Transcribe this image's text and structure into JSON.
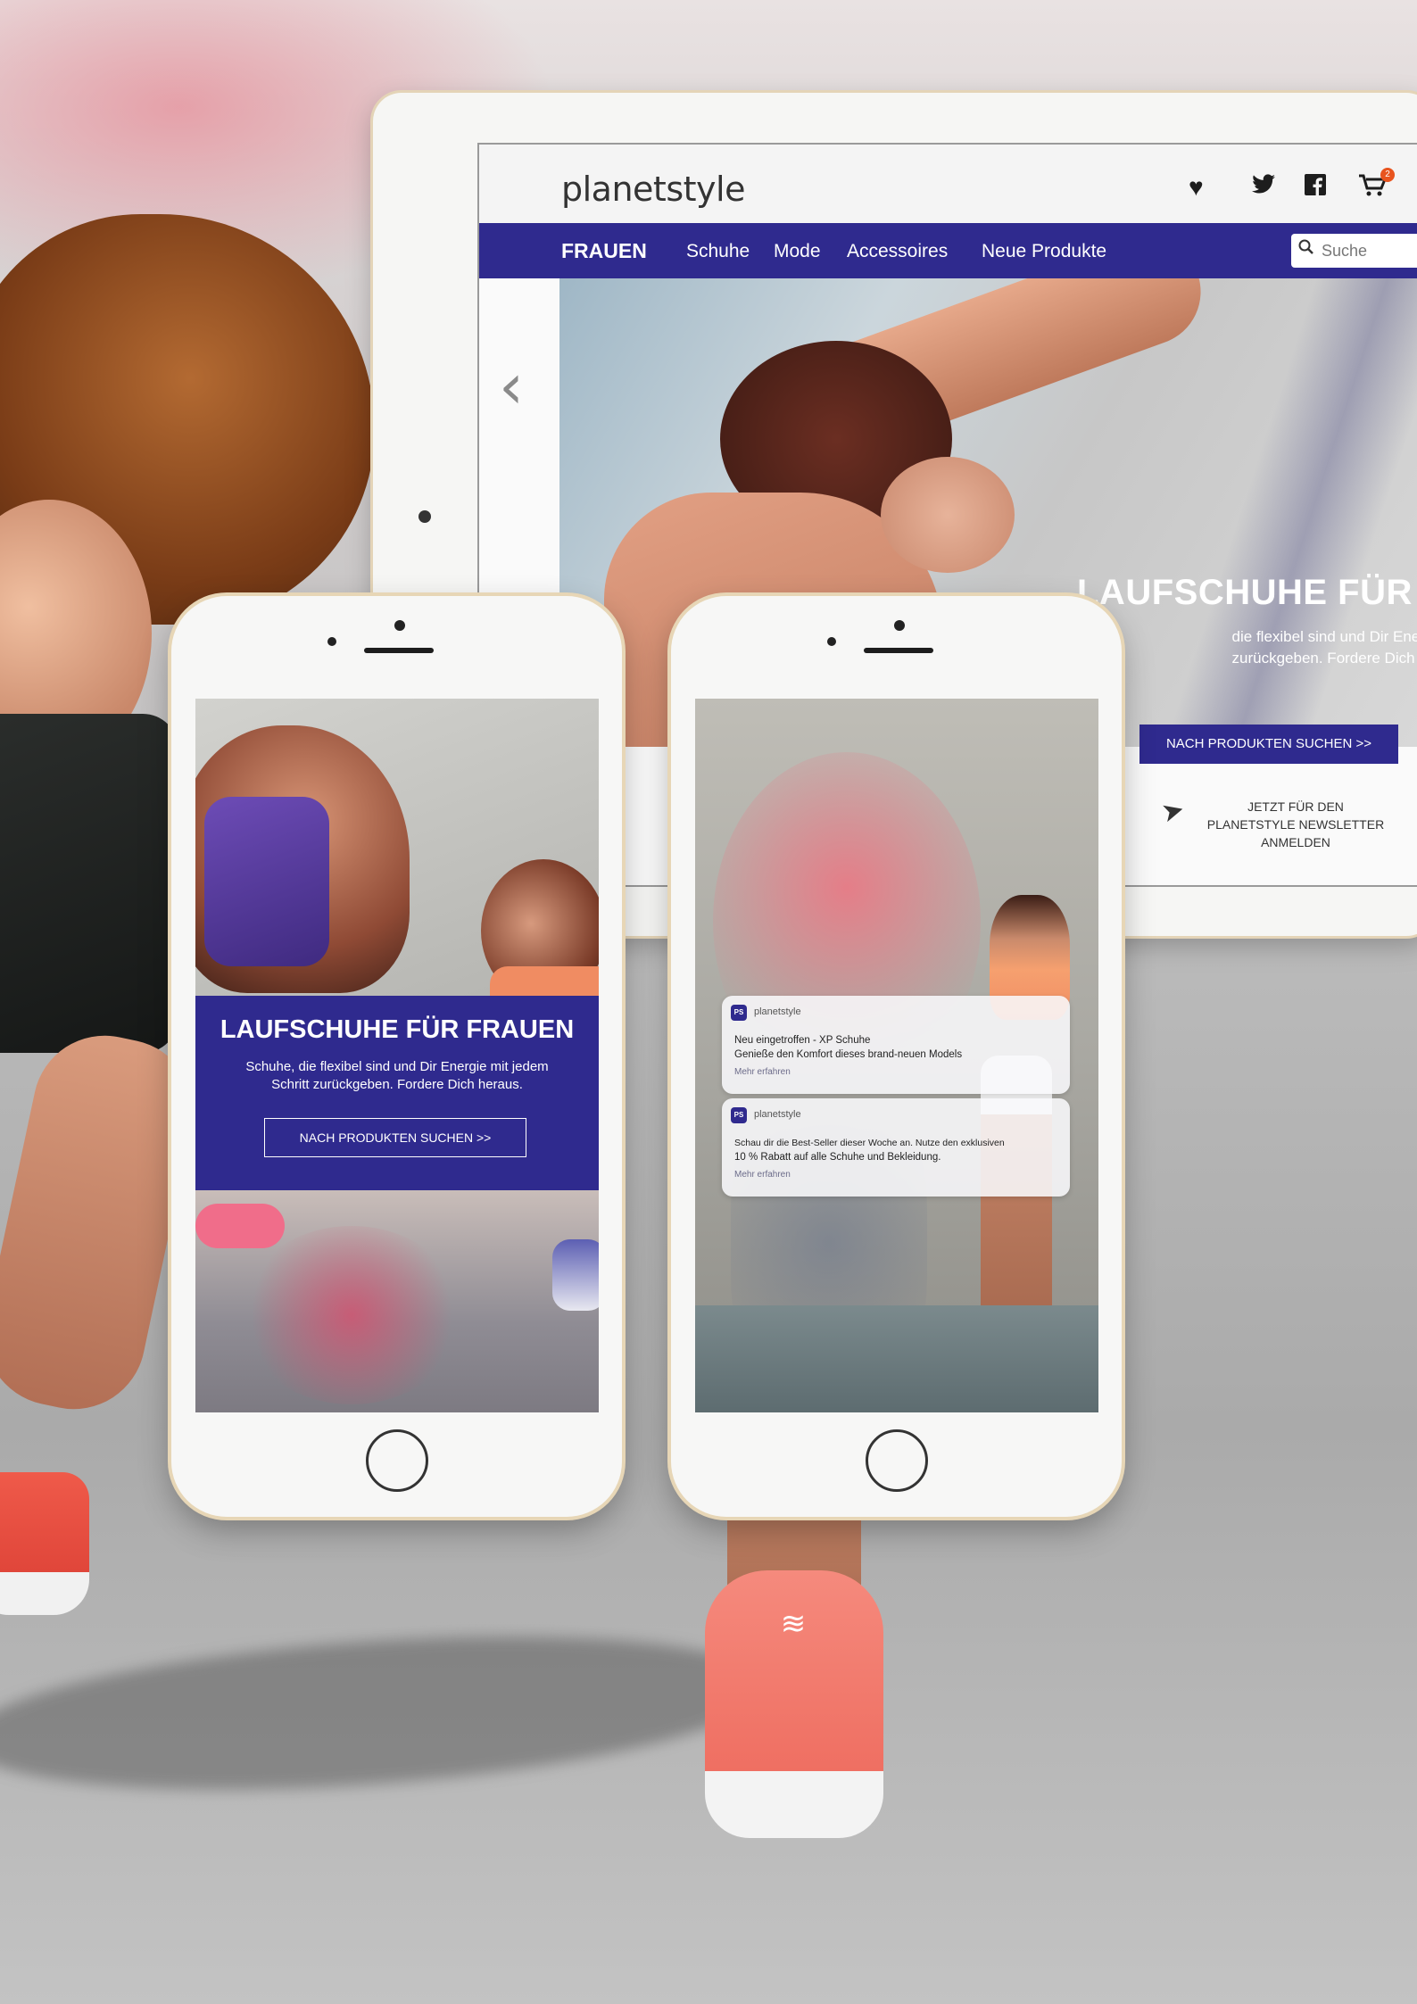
{
  "tablet": {
    "logo": "planetstyle",
    "cart_count": "2",
    "nav": {
      "primary": "FRAUEN",
      "items": [
        "Schuhe",
        "Mode",
        "Accessoires",
        "Neue Produkte"
      ]
    },
    "search_placeholder": "Suche",
    "hero": {
      "title": "LAUFSCHUHE FÜR FRAUEN",
      "text_line1": "die flexibel sind und Dir Energie mit",
      "text_line2": "zurückgeben. Fordere Dich heraus."
    },
    "cta_label": "NACH PRODUKTEN SUCHEN  >>",
    "newsletter": {
      "line1": "JETZT FÜR DEN",
      "line2": "PLANETSTYLE NEWSLETTER",
      "line3": "ANMELDEN"
    },
    "icons": [
      "heart-icon",
      "twitter-icon",
      "facebook-icon",
      "cart-icon",
      "search-icon",
      "chevron-left-icon",
      "paper-plane-icon"
    ]
  },
  "phone_a": {
    "title": "LAUFSCHUHE FÜR FRAUEN",
    "text_line1": "Schuhe, die flexibel sind und Dir Energie mit jedem",
    "text_line2": "Schritt zurückgeben. Fordere Dich heraus.",
    "button_label": "NACH PRODUKTEN SUCHEN  >>"
  },
  "phone_b": {
    "notifications": [
      {
        "app_icon": "PS",
        "app": "planetstyle",
        "line1": "Neu eingetroffen - XP Schuhe",
        "line2": "Genieße den Komfort dieses brand-neuen Models",
        "more": "Mehr erfahren"
      },
      {
        "app_icon": "PS",
        "app": "planetstyle",
        "line1": "Schau dir die Best-Seller dieser Woche an. Nutze den exklusiven",
        "line2": "10 % Rabatt auf alle Schuhe und Bekleidung.",
        "more": "Mehr erfahren"
      }
    ]
  },
  "colors": {
    "brand": "#2f2a8e",
    "badge": "#e8541e",
    "shoe": "#ef6f62"
  }
}
